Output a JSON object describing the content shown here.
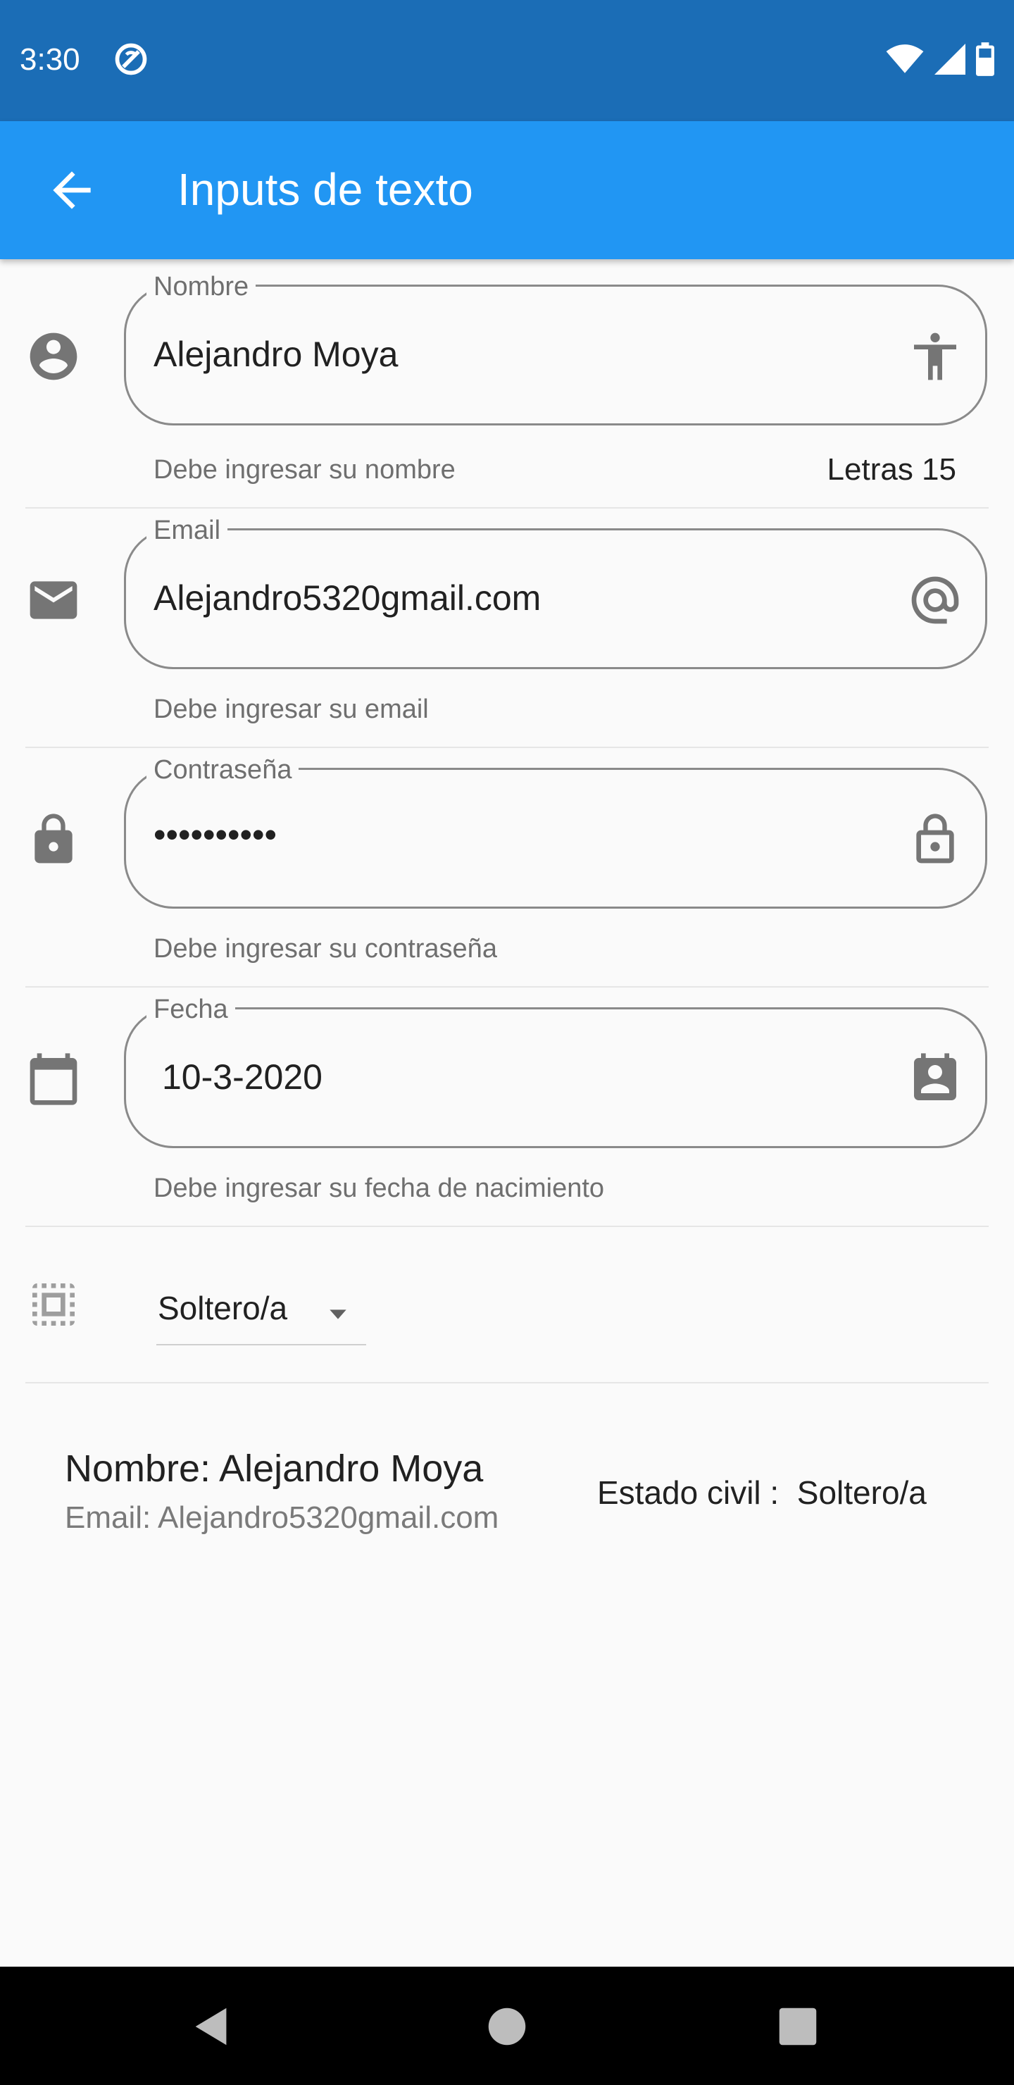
{
  "status_bar": {
    "time": "3:30",
    "icons": [
      "sync-icon",
      "wifi-icon",
      "signal-icon",
      "battery-icon"
    ]
  },
  "app_bar": {
    "title": "Inputs de texto",
    "back_icon": "arrow-back-icon"
  },
  "colors": {
    "status_bar": "#1b6db6",
    "app_bar": "#2196f3",
    "icon_gray": "#757575"
  },
  "fields": {
    "nombre": {
      "label": "Nombre",
      "value": "Alejandro Moya",
      "helper": "Debe ingresar su nombre",
      "counter": "Letras 15",
      "leading_icon": "account-circle-icon",
      "trailing_icon": "accessibility-icon"
    },
    "email": {
      "label": "Email",
      "value": "Alejandro5320gmail.com",
      "helper": "Debe ingresar su email",
      "leading_icon": "mail-icon",
      "trailing_icon": "at-sign-icon"
    },
    "password": {
      "label": "Contraseña",
      "value": "••••••••••",
      "helper": "Debe ingresar su contraseña",
      "leading_icon": "lock-icon",
      "trailing_icon": "lock-open-icon"
    },
    "fecha": {
      "label": "Fecha",
      "value": "10-3-2020",
      "helper": "Debe ingresar su fecha de nacimiento",
      "leading_icon": "calendar-icon",
      "trailing_icon": "contact-calendar-icon"
    }
  },
  "dropdown": {
    "value": "Soltero/a",
    "icon": "select-all-icon"
  },
  "summary": {
    "name": "Nombre: Alejandro Moya",
    "email": "Email: Alejandro5320gmail.com",
    "estado": "Estado civil :  Soltero/a"
  },
  "nav_bar": {
    "icons": [
      "back-triangle-icon",
      "home-circle-icon",
      "recents-square-icon"
    ]
  }
}
